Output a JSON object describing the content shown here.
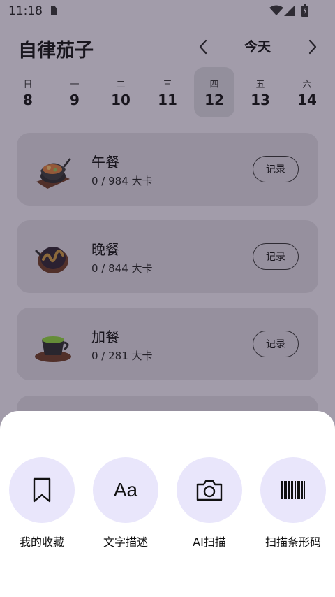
{
  "status_bar": {
    "time": "11:18"
  },
  "header": {
    "title": "自律茄子",
    "date_label": "今天"
  },
  "week": [
    {
      "weekday": "日",
      "date": "8"
    },
    {
      "weekday": "一",
      "date": "9"
    },
    {
      "weekday": "二",
      "date": "10"
    },
    {
      "weekday": "三",
      "date": "11"
    },
    {
      "weekday": "四",
      "date": "12",
      "selected": true
    },
    {
      "weekday": "五",
      "date": "13"
    },
    {
      "weekday": "六",
      "date": "14"
    }
  ],
  "meals": [
    {
      "name": "午餐",
      "calories": "0 / 984 大卡",
      "button": "记录",
      "icon": "pot-stew-icon"
    },
    {
      "name": "晚餐",
      "calories": "0 / 844 大卡",
      "button": "记录",
      "icon": "chocolate-plate-icon"
    },
    {
      "name": "加餐",
      "calories": "0 / 281 大卡",
      "button": "记录",
      "icon": "tea-cup-icon"
    }
  ],
  "sheet": {
    "actions": [
      {
        "label": "我的收藏",
        "icon": "bookmark-icon"
      },
      {
        "label": "文字描述",
        "icon": "text-aa-icon"
      },
      {
        "label": "AI扫描",
        "icon": "camera-icon"
      },
      {
        "label": "扫描条形码",
        "icon": "barcode-icon"
      }
    ],
    "aa_glyph": "Aa"
  },
  "colors": {
    "sheet_action_bg": "#e9e6fb",
    "card_bg": "#dad6df",
    "scrim": "#282034"
  }
}
